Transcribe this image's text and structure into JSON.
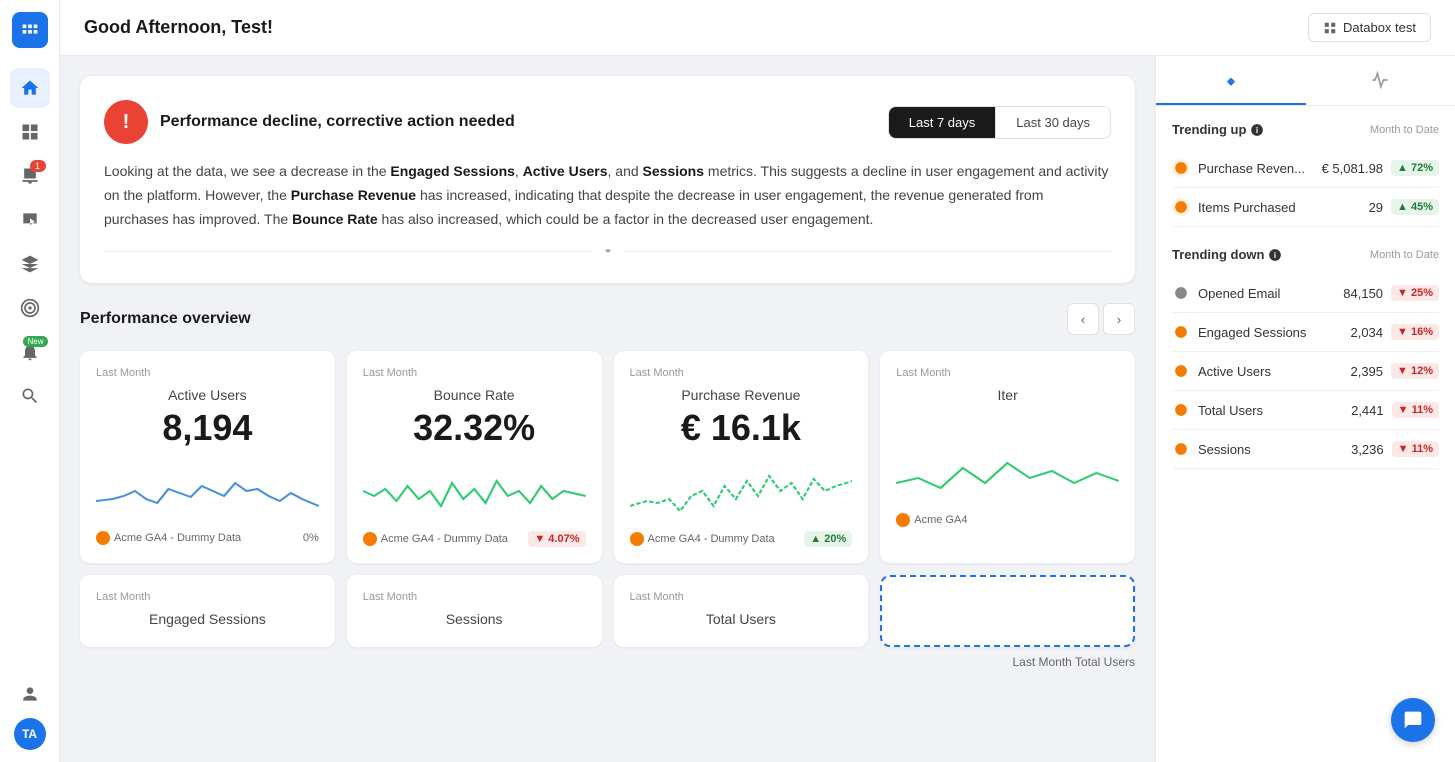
{
  "app": {
    "logo_label": "DB",
    "greeting": "Good Afternoon, Test!",
    "databox_btn": "Databox test"
  },
  "sidebar": {
    "items": [
      {
        "id": "home",
        "icon": "⌂",
        "active": true
      },
      {
        "id": "dashboard",
        "icon": "▦",
        "active": false
      },
      {
        "id": "alerts",
        "icon": "📊",
        "active": false,
        "badge": "1"
      },
      {
        "id": "video",
        "icon": "▶",
        "active": false
      },
      {
        "id": "layers",
        "icon": "⊞",
        "active": false
      },
      {
        "id": "target",
        "icon": "◎",
        "active": false
      },
      {
        "id": "bell",
        "icon": "🔔",
        "active": false,
        "badge_new": "New"
      },
      {
        "id": "search",
        "icon": "🔍",
        "active": false
      },
      {
        "id": "settings",
        "icon": "⚙",
        "active": false
      }
    ],
    "bottom": [
      {
        "id": "user",
        "icon": "👤"
      },
      {
        "id": "avatar",
        "label": "TA"
      }
    ]
  },
  "alert": {
    "icon": "!",
    "title": "Performance decline, corrective action needed",
    "time_options": [
      "Last 7 days",
      "Last 30 days"
    ],
    "active_time": "Last 7 days",
    "text_parts": [
      "Looking at the data, we see a decrease in the ",
      "Engaged Sessions",
      ", ",
      "Active Users",
      ", and ",
      "Sessions",
      " metrics. This suggests a decline in user engagement and activity on the platform. However, the ",
      "Purchase Revenue",
      " has increased, indicating that despite the decrease in user engagement, the revenue generated from purchases has improved. The ",
      "Bounce Rate",
      " has also increased, which could be a factor in the decreased user engagement."
    ]
  },
  "performance": {
    "title": "Performance overview",
    "cards": [
      {
        "period": "Last Month",
        "name": "Active Users",
        "value": "8,194",
        "source": "Acme GA4 - Dummy Data",
        "change": "0%",
        "change_type": "neutral",
        "chart_color": "#4a90d9"
      },
      {
        "period": "Last Month",
        "name": "Bounce Rate",
        "value": "32.32%",
        "source": "Acme GA4 - Dummy Data",
        "change": "4.07%",
        "change_type": "down",
        "chart_color": "#2ecc71"
      },
      {
        "period": "Last Month",
        "name": "Purchase Revenue",
        "value": "€ 16.1k",
        "source": "Acme GA4 - Dummy Data",
        "change": "20%",
        "change_type": "up",
        "chart_color": "#2ecc71"
      },
      {
        "period": "Last Month",
        "name": "Items Purchased",
        "value": "...",
        "source": "Acme GA4",
        "change": "",
        "change_type": "neutral",
        "chart_color": "#2ecc71"
      }
    ],
    "bottom_cards": [
      {
        "period": "Last Month",
        "name": "Engaged Sessions",
        "value": "",
        "source": "",
        "change": "",
        "change_type": "neutral",
        "chart_color": "#4a90d9"
      },
      {
        "period": "Last Month",
        "name": "Sessions",
        "value": "",
        "source": "",
        "change": "",
        "change_type": "neutral",
        "chart_color": "#4a90d9"
      },
      {
        "period": "Last Month",
        "name": "Total Users",
        "value": "",
        "source": "",
        "change": "",
        "change_type": "neutral",
        "chart_color": "#4a90d9"
      },
      {
        "period": "",
        "name": "",
        "value": "",
        "highlighted": true
      }
    ]
  },
  "right_sidebar": {
    "tabs": [
      {
        "id": "trending",
        "icon": "↑↓",
        "active": true
      },
      {
        "id": "pulse",
        "icon": "⚡",
        "active": false
      }
    ],
    "trending_up": {
      "title": "Trending up",
      "date_label": "Month to Date",
      "items": [
        {
          "name": "Purchase Reven...",
          "value": "€ 5,081.98",
          "change": "72%",
          "change_type": "up",
          "icon_color": "#f57c00"
        },
        {
          "name": "Items Purchased",
          "value": "29",
          "change": "45%",
          "change_type": "up",
          "icon_color": "#f57c00"
        }
      ]
    },
    "trending_down": {
      "title": "Trending down",
      "date_label": "Month to Date",
      "items": [
        {
          "name": "Opened Email",
          "value": "84,150",
          "change": "25%",
          "change_type": "down",
          "icon_color": "#666"
        },
        {
          "name": "Engaged Sessions",
          "value": "2,034",
          "change": "16%",
          "change_type": "down",
          "icon_color": "#f57c00"
        },
        {
          "name": "Active Users",
          "value": "2,395",
          "change": "12%",
          "change_type": "down",
          "icon_color": "#f57c00"
        },
        {
          "name": "Total Users",
          "value": "2,441",
          "change": "11%",
          "change_type": "down",
          "icon_color": "#f57c00"
        },
        {
          "name": "Sessions",
          "value": "3,236",
          "change": "11%",
          "change_type": "down",
          "icon_color": "#f57c00"
        }
      ]
    }
  },
  "footer": {
    "last_month_label": "Last Month Total Users"
  }
}
